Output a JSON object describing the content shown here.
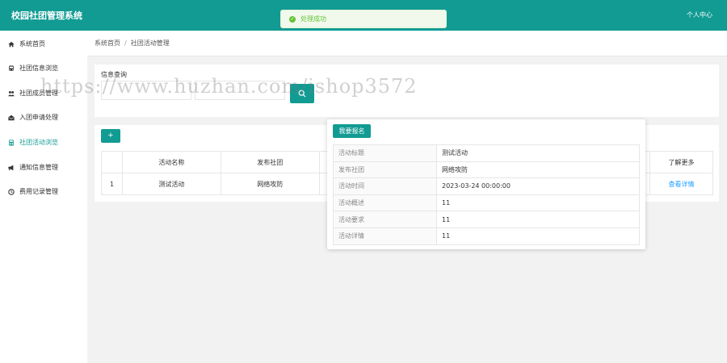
{
  "header": {
    "title": "校园社团管理系统",
    "user_center": "个人中心"
  },
  "toast": {
    "message": "处理成功"
  },
  "sidebar": {
    "items": [
      {
        "label": "系统首页",
        "icon": "home-icon",
        "active": false
      },
      {
        "label": "社团信息浏览",
        "icon": "bus-icon",
        "active": false
      },
      {
        "label": "社团成员管理",
        "icon": "group-icon",
        "active": false
      },
      {
        "label": "入团申请处理",
        "icon": "envelope-icon",
        "active": false
      },
      {
        "label": "社团活动浏览",
        "icon": "calculator-icon",
        "active": true
      },
      {
        "label": "通知信息管理",
        "icon": "bullhorn-icon",
        "active": false
      },
      {
        "label": "费用记录管理",
        "icon": "clock-icon",
        "active": false
      }
    ]
  },
  "breadcrumb": {
    "home": "系统首页",
    "current": "社团活动管理"
  },
  "query": {
    "title": "信息查询",
    "input1_placeholder": "",
    "input2_placeholder": ""
  },
  "table": {
    "headers": [
      "",
      "活动名称",
      "发布社团",
      "了解更多"
    ],
    "rows": [
      {
        "index": "1",
        "name": "测试活动",
        "club": "网络攻防",
        "action": "查看详情"
      }
    ]
  },
  "popup": {
    "signup_label": "我要报名",
    "fields": [
      {
        "key": "活动标题",
        "value": "测试活动"
      },
      {
        "key": "发布社团",
        "value": "网络攻防"
      },
      {
        "key": "活动时间",
        "value": "2023-03-24 00:00:00"
      },
      {
        "key": "活动概述",
        "value": "11"
      },
      {
        "key": "活动要求",
        "value": "11"
      },
      {
        "key": "活动详情",
        "value": "11"
      }
    ]
  },
  "watermark": "https://www.huzhan.com/ishop3572",
  "colors": {
    "brand": "#129b93",
    "success": "#67c23a",
    "link": "#1e9fff"
  }
}
